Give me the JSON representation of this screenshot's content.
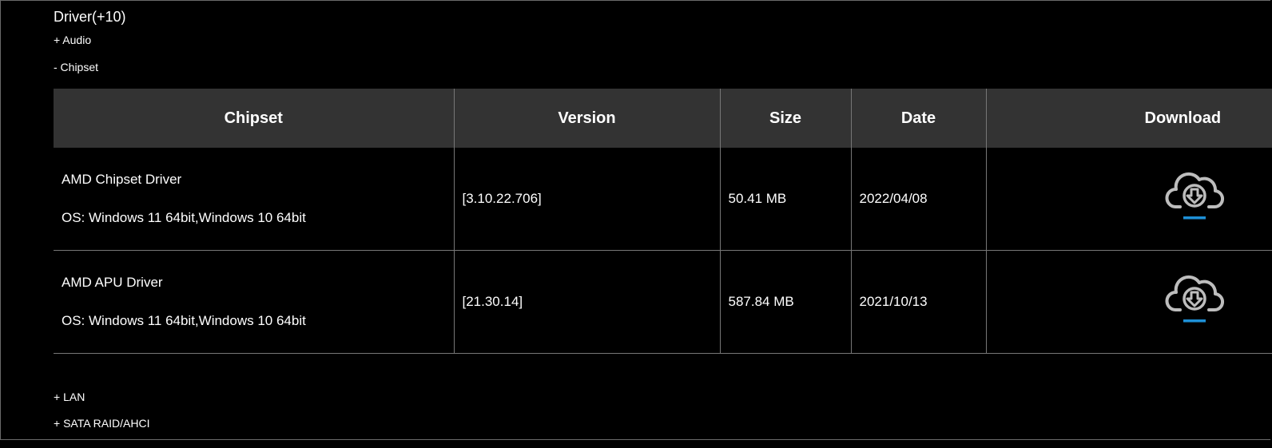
{
  "section": {
    "title": "Driver(+10)"
  },
  "categories": {
    "audio": "+ Audio",
    "chipset": "- Chipset",
    "lan": "+ LAN",
    "sata": "+ SATA RAID/AHCI"
  },
  "table": {
    "headers": {
      "name": "Chipset",
      "version": "Version",
      "size": "Size",
      "date": "Date",
      "download": "Download"
    },
    "rows": [
      {
        "name": "AMD Chipset Driver",
        "os": "OS: Windows 11 64bit,Windows 10 64bit",
        "version": "[3.10.22.706]",
        "size": "50.41 MB",
        "date": "2022/04/08",
        "download_icon": "cloud-download-icon"
      },
      {
        "name": "AMD APU Driver",
        "os": "OS: Windows 11 64bit,Windows 10 64bit",
        "version": "[21.30.14]",
        "size": "587.84 MB",
        "date": "2021/10/13",
        "download_icon": "cloud-download-icon"
      }
    ]
  },
  "colors": {
    "background": "#000000",
    "header_bg": "#333333",
    "icon_gray": "#bdbdbd",
    "icon_accent": "#1e90d6"
  }
}
